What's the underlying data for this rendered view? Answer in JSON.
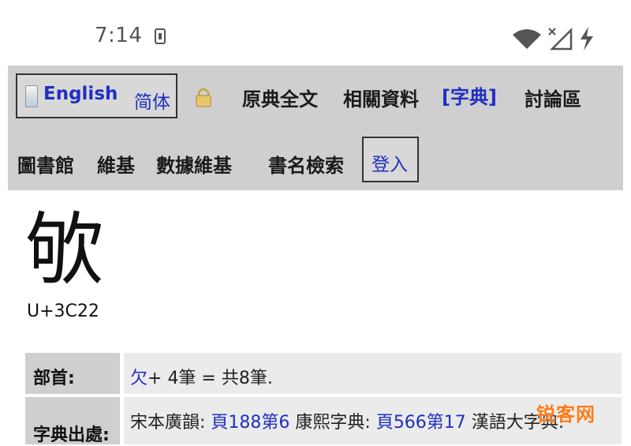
{
  "status_bar": {
    "time": "7:14"
  },
  "nav": {
    "lang_english": "English",
    "lang_simplified": "简体",
    "items": [
      "原典全文",
      "相關資料",
      "[字典]",
      "討論區"
    ],
    "items_row2": [
      "圖書館",
      "維基",
      "數據維基",
      "書名檢索"
    ],
    "login": "登入"
  },
  "entry": {
    "character": "欨",
    "codepoint": "U+3C22"
  },
  "table": {
    "radical_label": "部首:",
    "radical_link": "欠",
    "radical_text": "+ 4筆 = 共8筆.",
    "sources_label": "字典出處:",
    "sources_prefix": "宋本廣韻: ",
    "sources_link1": "頁188第6",
    "sources_mid": " 康熙字典: ",
    "sources_link2": "頁566第17",
    "sources_suffix": " 漢語大字典:"
  },
  "watermark": "锐客网",
  "colors": {
    "link": "#2030c0",
    "nav_bg": "#cfcfcf",
    "watermark": "#ff7a1a"
  }
}
